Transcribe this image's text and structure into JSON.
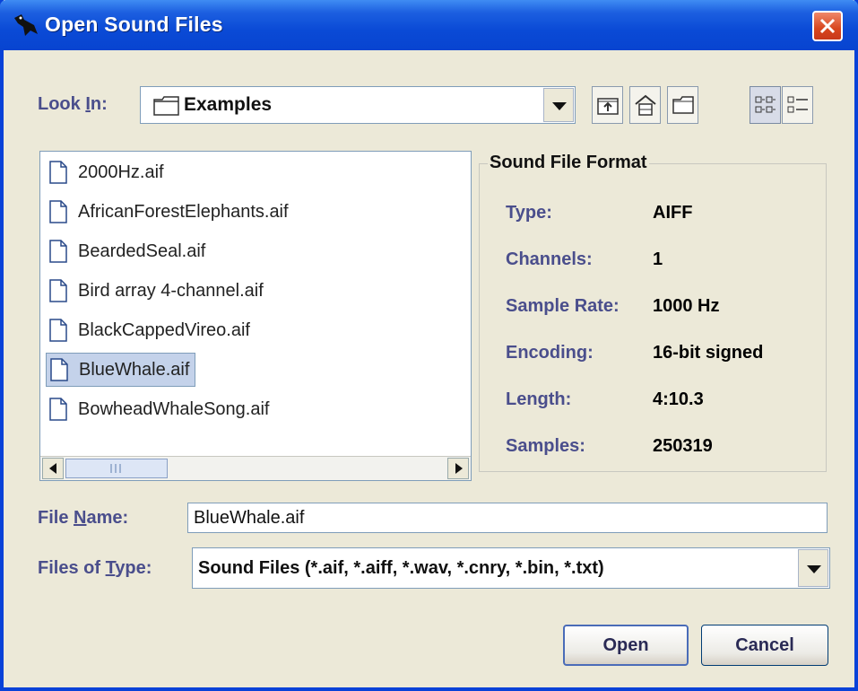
{
  "window": {
    "title": "Open Sound Files"
  },
  "look_in": {
    "label_pre": "Look ",
    "label_mnemonic": "I",
    "label_post": "n:",
    "value": "Examples",
    "icon": "folder-icon"
  },
  "toolbar": {
    "buttons": [
      {
        "name": "up-one-level",
        "icon": "folder-up-icon"
      },
      {
        "name": "home",
        "icon": "home-icon"
      },
      {
        "name": "new-folder",
        "icon": "new-folder-icon"
      },
      {
        "name": "list-view",
        "icon": "list-view-icon",
        "pressed": true
      },
      {
        "name": "details-view",
        "icon": "details-view-icon"
      }
    ]
  },
  "files": [
    "2000Hz.aif",
    "AfricanForestElephants.aif",
    "BeardedSeal.aif",
    "Bird array 4-channel.aif",
    "BlackCappedVireo.aif",
    "BlueWhale.aif",
    "BowheadWhaleSong.aif"
  ],
  "selected_file": "BlueWhale.aif",
  "format": {
    "title": "Sound File Format",
    "rows": [
      {
        "key": "Type:",
        "value": "AIFF"
      },
      {
        "key": "Channels:",
        "value": "1"
      },
      {
        "key": "Sample Rate:",
        "value": "1000 Hz"
      },
      {
        "key": "Encoding:",
        "value": "16-bit signed"
      },
      {
        "key": "Length:",
        "value": "4:10.3"
      },
      {
        "key": "Samples:",
        "value": "250319"
      }
    ]
  },
  "file_name": {
    "label_pre": "File ",
    "label_mnemonic": "N",
    "label_post": "ame:",
    "value": "BlueWhale.aif"
  },
  "file_type": {
    "label_pre": "Files of ",
    "label_mnemonic": "T",
    "label_post": "ype:",
    "value": "Sound Files (*.aif, *.aiff, *.wav, *.cnry, *.bin, *.txt)"
  },
  "buttons": {
    "open": "Open",
    "cancel": "Cancel"
  },
  "colors": {
    "title_bar": "#0a4ad6",
    "label": "#4a4e8c",
    "selection": "#c4d2ea",
    "close": "#d8461e"
  }
}
